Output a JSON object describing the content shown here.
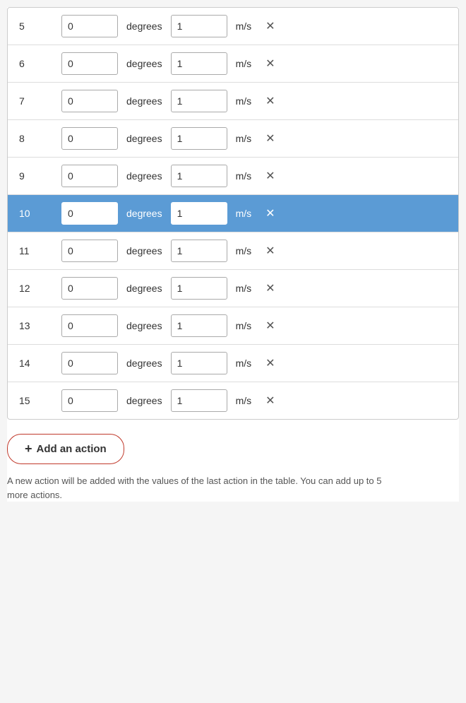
{
  "rows": [
    {
      "id": 5,
      "angle": "0",
      "speed": "1",
      "highlighted": false
    },
    {
      "id": 6,
      "angle": "0",
      "speed": "1",
      "highlighted": false
    },
    {
      "id": 7,
      "angle": "0",
      "speed": "1",
      "highlighted": false
    },
    {
      "id": 8,
      "angle": "0",
      "speed": "1",
      "highlighted": false
    },
    {
      "id": 9,
      "angle": "0",
      "speed": "1",
      "highlighted": false
    },
    {
      "id": 10,
      "angle": "0",
      "speed": "1",
      "highlighted": true
    },
    {
      "id": 11,
      "angle": "0",
      "speed": "1",
      "highlighted": false
    },
    {
      "id": 12,
      "angle": "0",
      "speed": "1",
      "highlighted": false
    },
    {
      "id": 13,
      "angle": "0",
      "speed": "1",
      "highlighted": false
    },
    {
      "id": 14,
      "angle": "0",
      "speed": "1",
      "highlighted": false
    },
    {
      "id": 15,
      "angle": "0",
      "speed": "1",
      "highlighted": false
    }
  ],
  "units": {
    "angle": "degrees",
    "speed": "m/s"
  },
  "add_action": {
    "label": "Add an action",
    "plus": "+"
  },
  "hint": "A new action will be added with the values of the last action in the table. You can add up to 5 more actions."
}
